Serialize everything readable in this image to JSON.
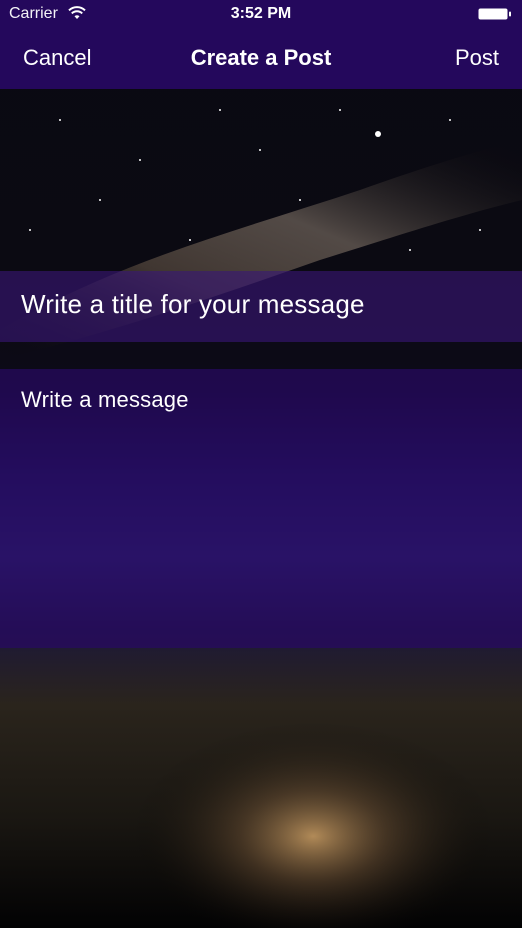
{
  "status_bar": {
    "carrier": "Carrier",
    "time": "3:52 PM"
  },
  "nav": {
    "cancel_label": "Cancel",
    "title": "Create a Post",
    "post_label": "Post"
  },
  "form": {
    "title_placeholder": "Write a title for your message",
    "message_placeholder": "Write a message"
  },
  "colors": {
    "nav_bar": "#24085c",
    "field_overlay": "#2a0a66"
  }
}
